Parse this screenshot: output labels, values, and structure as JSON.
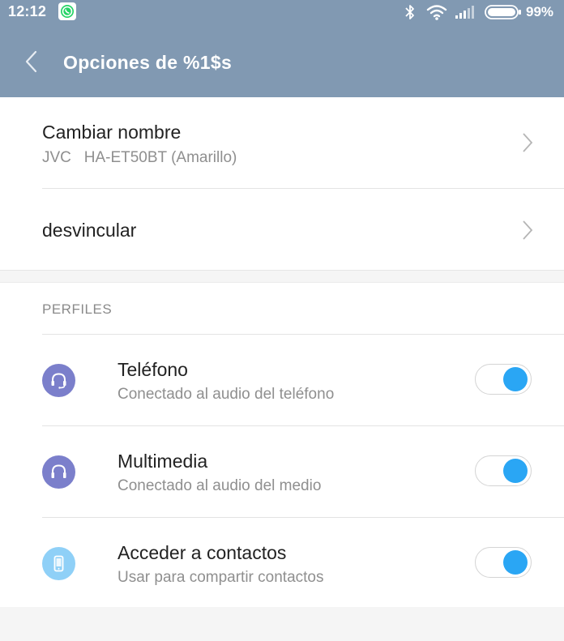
{
  "status_bar": {
    "time": "12:12",
    "battery_percent": "99%",
    "icons": [
      "whatsapp-icon",
      "bluetooth-icon",
      "wifi-icon",
      "signal-icon",
      "battery-icon"
    ]
  },
  "app_bar": {
    "title": "Opciones de %1$s",
    "back_icon": "back-icon"
  },
  "device": {
    "rename_label": "Cambiar nombre",
    "device_name": "JVC   HA-ET50BT (Amarillo)",
    "unpair_label": "desvincular"
  },
  "profiles": {
    "section_title": "PERFILES",
    "items": [
      {
        "title": "Teléfono",
        "subtitle": "Conectado al audio del teléfono",
        "icon": "headset-icon",
        "enabled": true
      },
      {
        "title": "Multimedia",
        "subtitle": "Conectado al audio del medio",
        "icon": "headphones-icon",
        "enabled": true
      },
      {
        "title": "Acceder a contactos",
        "subtitle": "Usar para compartir contactos",
        "icon": "phone-icon",
        "enabled": true
      }
    ]
  },
  "colors": {
    "app_bar": "#8199b2",
    "toggle_on": "#2aa6f4",
    "audio_icon_bg": "#7b7fcb",
    "contacts_icon_bg": "#8fd0f7"
  }
}
